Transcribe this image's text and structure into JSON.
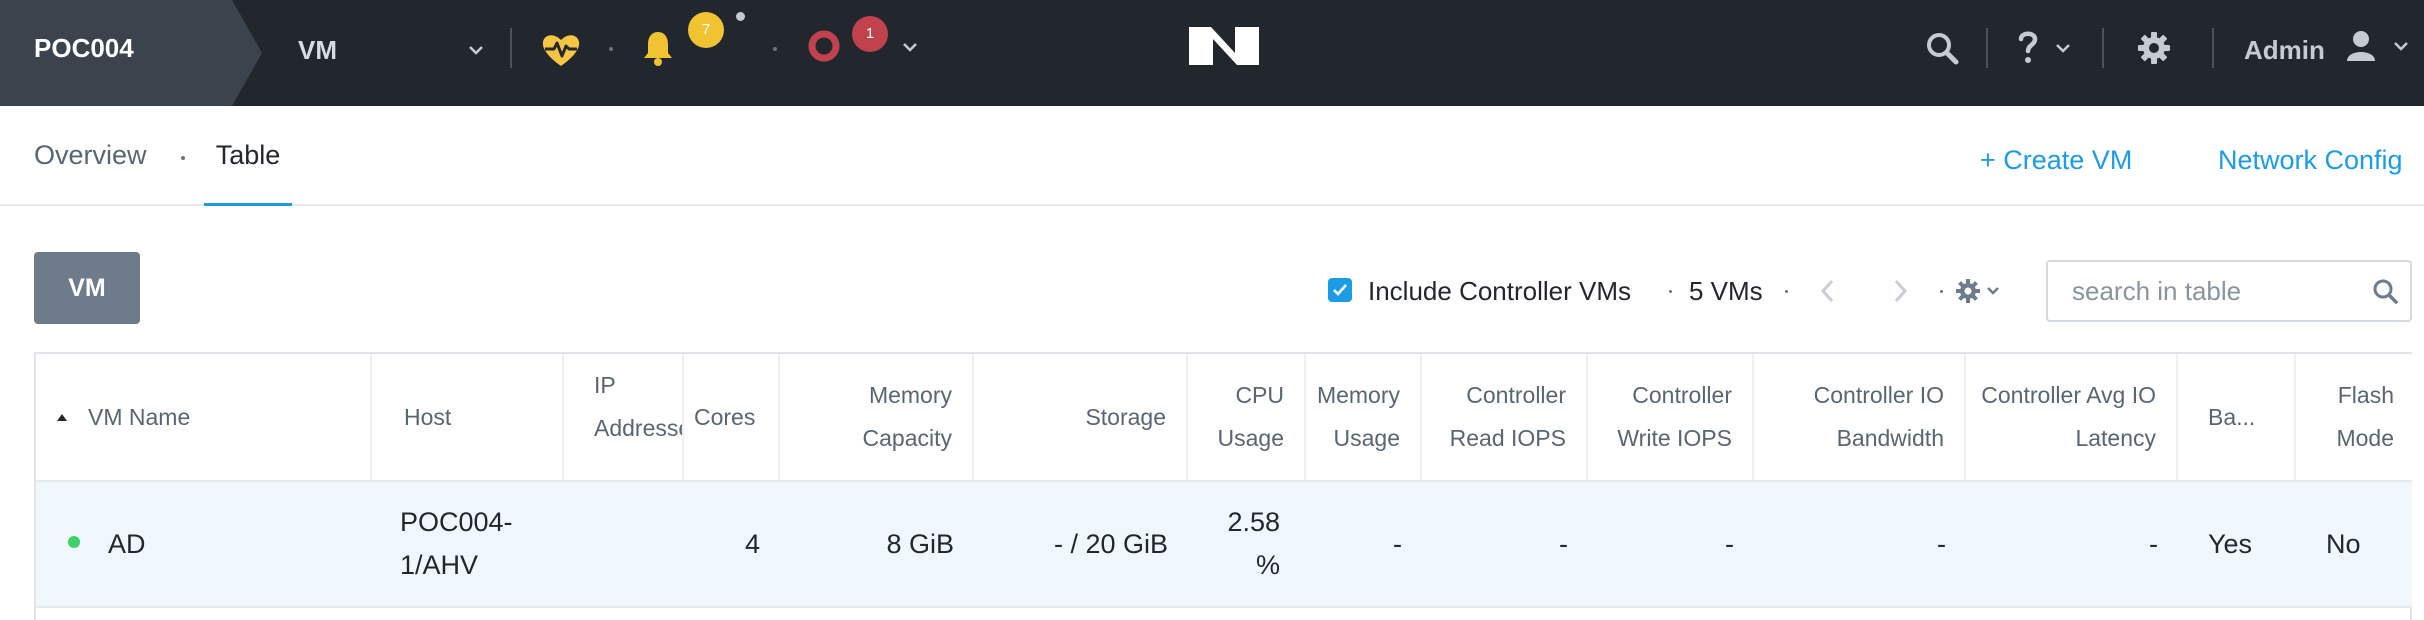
{
  "topbar": {
    "cluster_name": "POC004",
    "entity_selector": "VM",
    "alerts_count": "7",
    "critical_count": "1",
    "user": "Admin"
  },
  "subnav": {
    "tabs": [
      {
        "label": "Overview"
      },
      {
        "label": "Table"
      }
    ],
    "create_vm": "+ Create VM",
    "network_config": "Network Config"
  },
  "toolbar": {
    "vm_button": "VM",
    "include_controller": "Include Controller VMs",
    "include_controller_checked": true,
    "vm_count": "5 VMs",
    "search_placeholder": "search in table"
  },
  "table": {
    "columns": [
      {
        "line1": "VM Name",
        "line2": ""
      },
      {
        "line1": "Host",
        "line2": ""
      },
      {
        "line1": "IP",
        "line2": "Addresses"
      },
      {
        "line1": "Cores",
        "line2": ""
      },
      {
        "line1": "Memory",
        "line2": "Capacity"
      },
      {
        "line1": "Storage",
        "line2": ""
      },
      {
        "line1": "CPU",
        "line2": "Usage"
      },
      {
        "line1": "Memory",
        "line2": "Usage"
      },
      {
        "line1": "Controller",
        "line2": "Read IOPS"
      },
      {
        "line1": "Controller",
        "line2": "Write IOPS"
      },
      {
        "line1": "Controller IO",
        "line2": "Bandwidth"
      },
      {
        "line1": "Controller Avg IO",
        "line2": "Latency"
      },
      {
        "line1": "Ba...",
        "line2": ""
      },
      {
        "line1": "Flash",
        "line2": "Mode"
      }
    ],
    "rows": [
      {
        "status": "green",
        "vm_name": "AD",
        "host_line1": "POC004-",
        "host_line2": "1/AHV",
        "ip": "",
        "cores": "4",
        "memory_capacity": "8 GiB",
        "storage": "- / 20 GiB",
        "cpu_usage_line1": "2.58",
        "cpu_usage_line2": "%",
        "memory_usage": "-",
        "ctrl_read_iops": "-",
        "ctrl_write_iops": "-",
        "ctrl_io_bandwidth": "-",
        "ctrl_avg_io_latency": "-",
        "backup": "Yes",
        "flash_mode": "No"
      }
    ]
  },
  "colors": {
    "topbar_bg": "#22272e",
    "accent": "#1b9ce4",
    "alert_yellow": "#f1c232",
    "critical_red": "#c1424c",
    "health_yellow": "#f6c544",
    "status_green": "#3fd26a"
  }
}
